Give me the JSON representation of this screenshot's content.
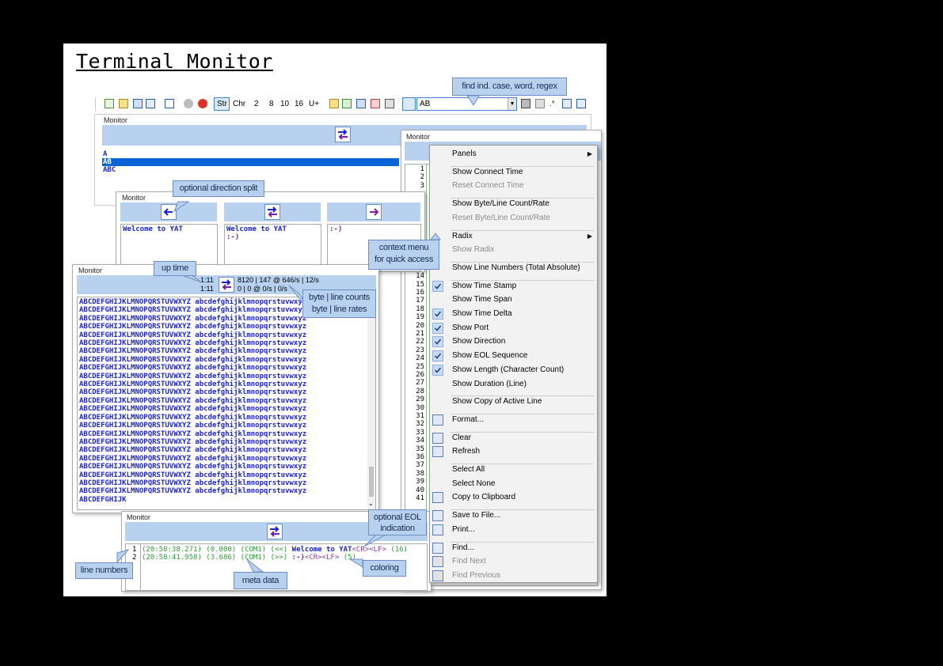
{
  "title": "Terminal Monitor",
  "toolbar": {
    "buttons": [
      "Str",
      "Chr",
      "2",
      "8",
      "10",
      "16",
      "U+"
    ],
    "find_value": "AB"
  },
  "panel_label": "Monitor",
  "find_panel": {
    "lines": [
      "A",
      "AB",
      "ABC"
    ]
  },
  "split_panel": {
    "tx_lines": [
      "Welcome to YAT"
    ],
    "bidir_lines": [
      "Welcome to YAT",
      ":-)"
    ],
    "rx_lines": [
      ":-)"
    ]
  },
  "count_panel": {
    "uptime_1": "1:11",
    "uptime_2": "1:11",
    "counts": "8120 | 147 @ 646/s | 12/s",
    "rates": "0 | 0 @ 0/s | 0/s",
    "line_text": "ABCDEFGHIJKLMNOPQRSTUVWXYZ abcdefghijklmnopqrstuvwxyz",
    "line_count": 24,
    "last_line": "ABCDEFGHIJK"
  },
  "eol_panel": {
    "rows": [
      {
        "num": "1",
        "meta": "(20:58:38.271) (0.000) (COM1) (<<) ",
        "text": "Welcome to YAT",
        "eol": "<CR><LF>",
        "len": " (16)"
      },
      {
        "num": "2",
        "meta": "(20:58:41.958) (3.686) (COM1) (>>) ",
        "text": ":-)",
        "eol": "<CR><LF>",
        "len": " (5)"
      }
    ]
  },
  "right_panel": {
    "line_numbers": [
      "1",
      "2",
      "3",
      "",
      "",
      "",
      "",
      "",
      "",
      "",
      "",
      "",
      "",
      "14",
      "15",
      "16",
      "17",
      "18",
      "19",
      "20",
      "21",
      "22",
      "23",
      "24",
      "25",
      "26",
      "27",
      "28",
      "29",
      "30",
      "31",
      "32",
      "33",
      "34",
      "35",
      "36",
      "37",
      "38",
      "39",
      "40",
      "41"
    ]
  },
  "context_menu": {
    "items": [
      {
        "label": "Panels",
        "submenu": true
      },
      {
        "label": "Show Connect Time"
      },
      {
        "label": "Reset Connect Time",
        "disabled": true
      },
      {
        "label": "Show Byte/Line Count/Rate"
      },
      {
        "label": "Reset Byte/Line Count/Rate",
        "disabled": true
      },
      {
        "label": "Radix",
        "submenu": true
      },
      {
        "label": "Show Radix",
        "disabled": true
      },
      {
        "label": "Show Line Numbers (Total Absolute)"
      },
      {
        "label": "Show Time Stamp",
        "checked": true
      },
      {
        "label": "Show Time Span"
      },
      {
        "label": "Show Time Delta",
        "checked": true
      },
      {
        "label": "Show Port",
        "checked": true
      },
      {
        "label": "Show Direction",
        "checked": true
      },
      {
        "label": "Show EOL Sequence",
        "checked": true
      },
      {
        "label": "Show Length (Character Count)",
        "checked": true
      },
      {
        "label": "Show Duration (Line)"
      },
      {
        "label": "Show Copy of Active Line"
      },
      {
        "label": "Format..."
      },
      {
        "label": "Clear"
      },
      {
        "label": "Refresh"
      },
      {
        "label": "Select All"
      },
      {
        "label": "Select None"
      },
      {
        "label": "Copy to Clipboard"
      },
      {
        "label": "Save to File..."
      },
      {
        "label": "Print..."
      },
      {
        "label": "Find..."
      },
      {
        "label": "Find Next",
        "disabled": true
      },
      {
        "label": "Find Previous",
        "disabled": true
      }
    ]
  },
  "callouts": {
    "find": "find ind. case, word, regex",
    "direction": "optional direction split",
    "context": "context menu\nfor quick access",
    "uptime": "up time",
    "counts": "byte | line counts\nbyte | line rates",
    "eol": "optional EOL\nindication",
    "line_numbers": "line numbers",
    "coloring": "coloring",
    "meta": "meta data"
  },
  "colors": {
    "tx_text": "#1c23d6",
    "rx_text": "#7a1fa8",
    "meta": "#2f9a3a",
    "eol": "#8a3aa8",
    "panel_bar": "#b8d1ee",
    "selection": "#0a64d8"
  }
}
